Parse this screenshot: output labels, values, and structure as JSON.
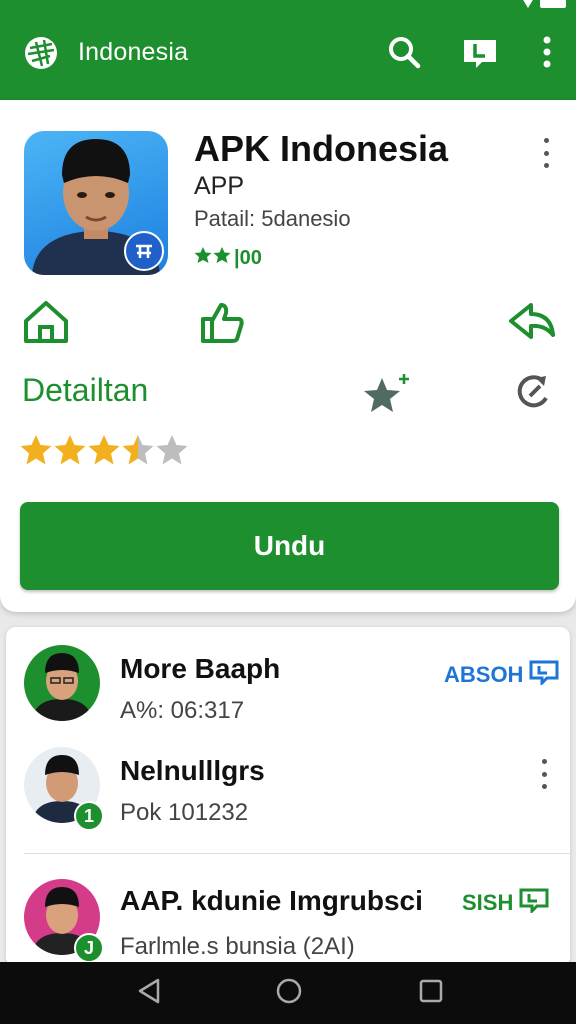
{
  "app_bar": {
    "title": "Indonesia",
    "actions": [
      "search-icon",
      "bookmark-icon",
      "more-vert-icon"
    ]
  },
  "app": {
    "name": "APK Indonesia",
    "subtitle": "APP",
    "detail": "Patail: 5danesio",
    "rating_text": "|00",
    "actions": [
      "home-icon",
      "thumbs-up-icon",
      "share-icon"
    ],
    "details_label": "Detailtan",
    "rating": 3.5,
    "rating_max": 5,
    "download_label": "Undu"
  },
  "list": [
    {
      "title": "More Baaph",
      "subtitle": "A%: 06:317",
      "tag": "ABSOH",
      "tag_color": "#1e75d3"
    },
    {
      "title": "Nelnulllgrs",
      "subtitle": "Pok 101232",
      "badge": "1"
    },
    {
      "title": "AAP. kdunie Imgrubsci",
      "subtitle": "Farlmle.s bunsia (2AI)",
      "tag": "SISH",
      "tag_color": "#1e8f2e",
      "badge": "J"
    }
  ],
  "colors": {
    "primary": "#1e8f2e",
    "accent_blue": "#1e75d3",
    "star": "#f2b01e"
  }
}
